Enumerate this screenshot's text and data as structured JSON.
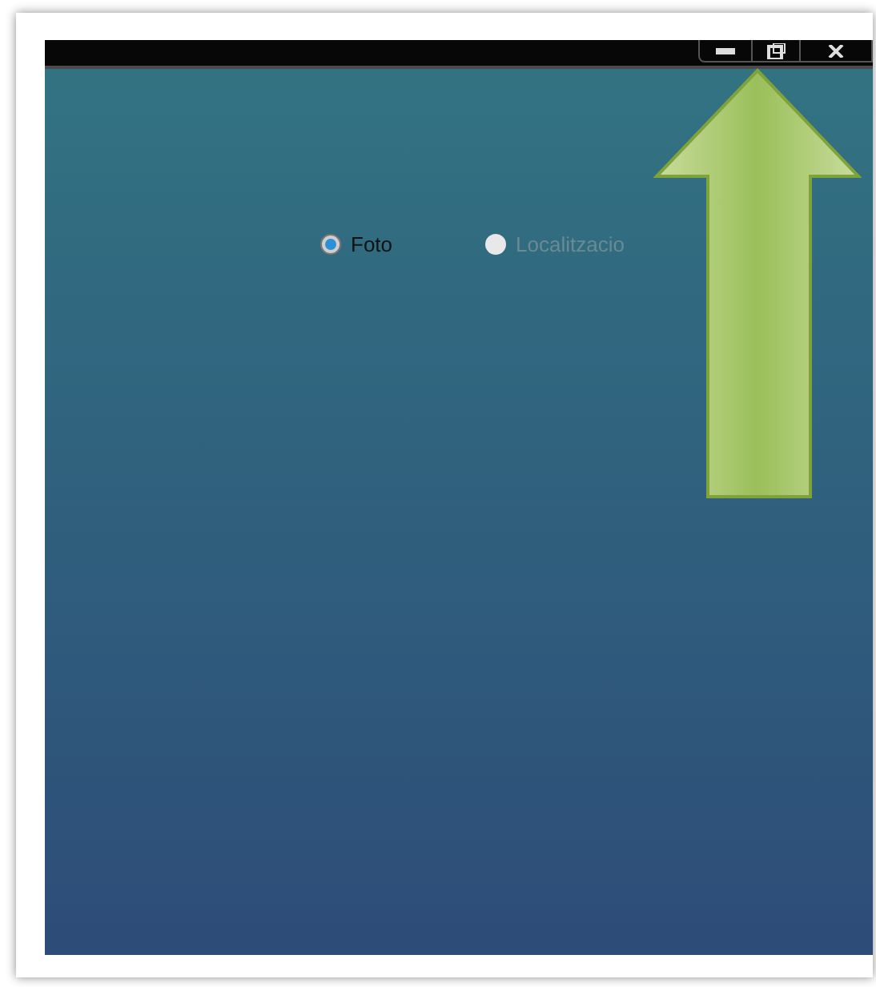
{
  "options": [
    {
      "label": "Foto",
      "selected": true,
      "disabled": false
    },
    {
      "label": "Localitzacio",
      "selected": false,
      "disabled": true
    }
  ]
}
